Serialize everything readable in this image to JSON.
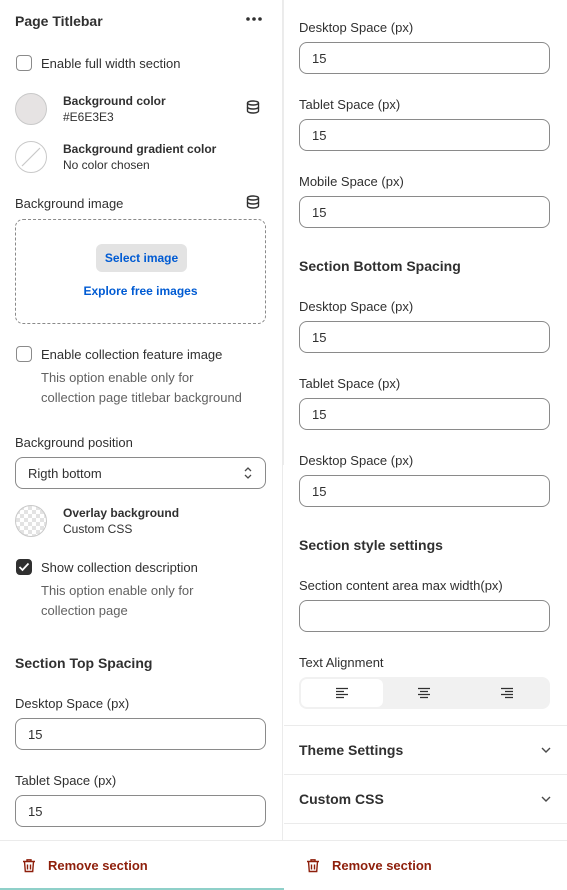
{
  "left": {
    "header_title": "Page Titlebar",
    "more_icon": "more-horizontal-icon",
    "enable_full_width": "Enable full width section",
    "bg_color_label": "Background color",
    "bg_color_value": "#E6E3E3",
    "bg_gradient_label": "Background gradient color",
    "bg_gradient_value": "No color chosen",
    "bg_image_label": "Background image",
    "select_image": "Select image",
    "explore_images": "Explore free images",
    "enable_collection_image": "Enable collection feature image",
    "collection_image_help_1": "This option enable only for",
    "collection_image_help_2": "collection page titlebar background",
    "bg_position_label": "Background position",
    "bg_position_value": "Rigth bottom",
    "overlay_label": "Overlay background",
    "overlay_value": "Custom CSS",
    "show_description": "Show collection description",
    "description_help_1": "This option enable only for",
    "description_help_2": "collection page",
    "top_spacing_title": "Section Top Spacing",
    "desktop_label": "Desktop Space (px)",
    "desktop_value": "15",
    "tablet_label": "Tablet Space (px)",
    "tablet_value": "15",
    "remove_section": "Remove section"
  },
  "right": {
    "desktop_label": "Desktop Space (px)",
    "desktop_value": "15",
    "tablet_label": "Tablet Space (px)",
    "tablet_value": "15",
    "mobile_label": "Mobile Space (px)",
    "mobile_value": "15",
    "bottom_spacing_title": "Section Bottom Spacing",
    "b_desktop_label": "Desktop Space (px)",
    "b_desktop_value": "15",
    "b_tablet_label": "Tablet Space (px)",
    "b_tablet_value": "15",
    "b_desktop2_label": "Desktop Space (px)",
    "b_desktop2_value": "15",
    "style_title": "Section style settings",
    "max_width_label": "Section content area max width(px)",
    "max_width_value": "",
    "text_align_label": "Text Alignment",
    "theme_settings": "Theme Settings",
    "custom_css": "Custom CSS",
    "remove_section": "Remove section"
  },
  "colors": {
    "bg_color": "#E6E3E3",
    "link_blue": "#005bd3",
    "danger": "#8e1f0b"
  }
}
